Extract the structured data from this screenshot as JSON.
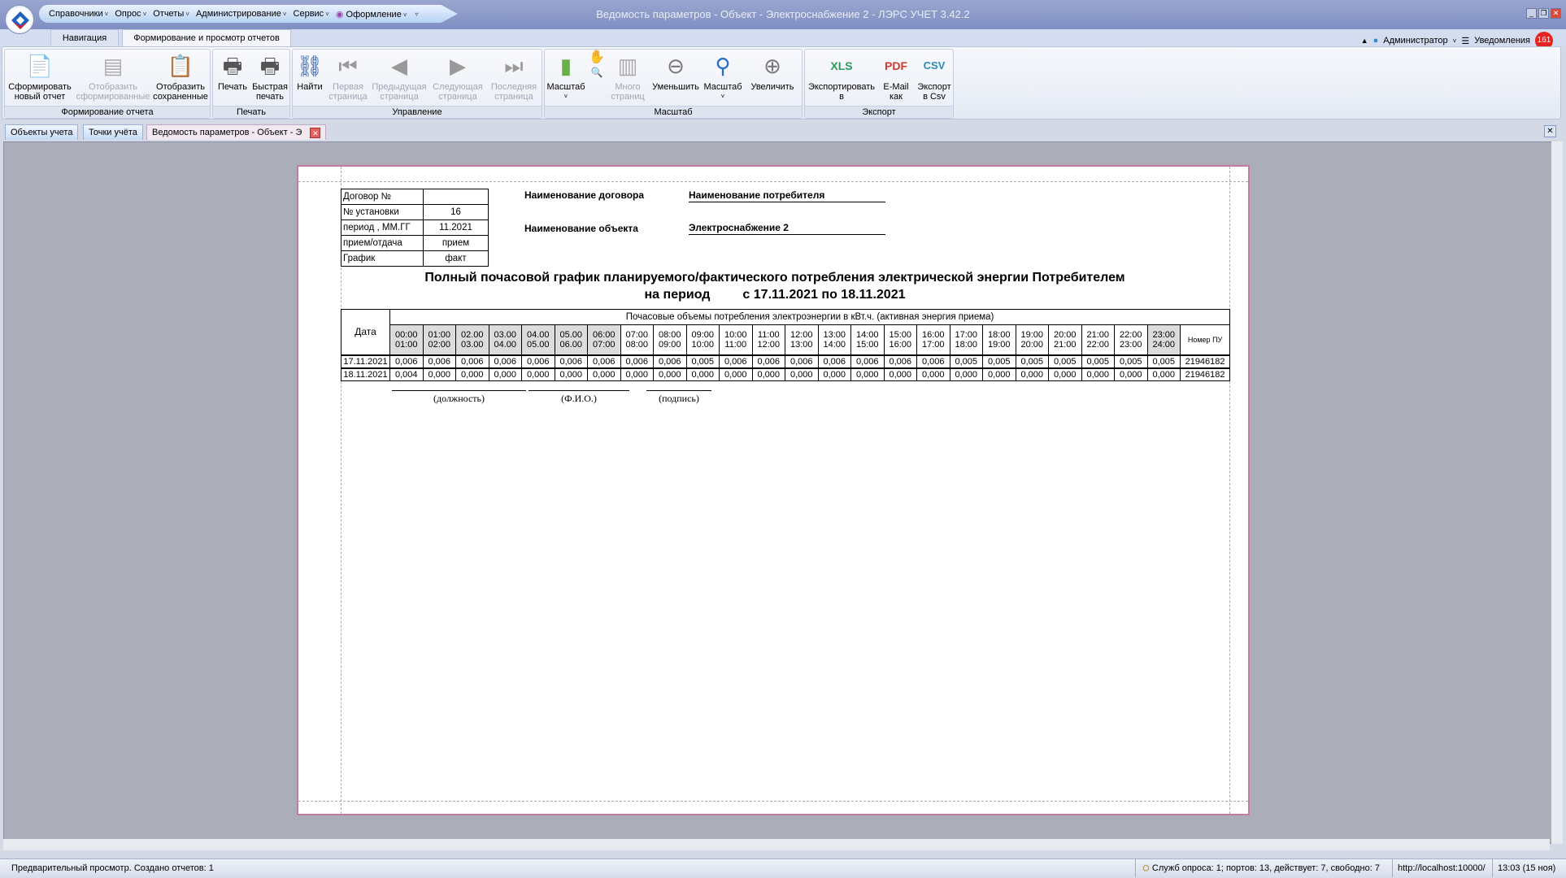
{
  "window": {
    "title": "Ведомость параметров - Объект - Электроснабжение 2 - ЛЭРС УЧЕТ 3.42.2"
  },
  "menu": [
    "Справочники",
    "Опрос",
    "Отчеты",
    "Администрирование",
    "Сервис",
    "Оформление"
  ],
  "ribbon_tabs": [
    "Навигация",
    "Формирование и просмотр отчетов"
  ],
  "user": {
    "name": "Администратор",
    "notifications_label": "Уведомления",
    "notifications_count": "161"
  },
  "groups": {
    "report": {
      "label": "Формирование отчета",
      "buttons": [
        "Сформировать\nновый отчет",
        "Отобразить\nсформированные",
        "Отобразить\nсохраненные"
      ]
    },
    "print": {
      "label": "Печать",
      "buttons": [
        "Печать",
        "Быстрая\nпечать"
      ]
    },
    "nav": {
      "label": "Управление",
      "buttons": [
        "Найти",
        "Первая\nстраница",
        "Предыдущая\nстраница",
        "Следующая\nстраница",
        "Последняя\nстраница"
      ]
    },
    "zoom": {
      "label": "Масштаб",
      "buttons": [
        "Масштаб",
        "Много\nстраниц",
        "Уменьшить",
        "Масштаб",
        "Увеличить"
      ]
    },
    "export": {
      "label": "Экспорт",
      "buttons": [
        "Экспортировать\nв",
        "E-Mail\nкак",
        "Экспорт\nв Csv"
      ]
    }
  },
  "doc_tabs": [
    "Объекты учета",
    "Точки учёта",
    "Ведомость параметров - Объект - Э"
  ],
  "report": {
    "info": [
      [
        "Договор №",
        ""
      ],
      [
        "№ установки",
        "16"
      ],
      [
        "период , ММ.ГГ",
        "11.2021"
      ],
      [
        "прием/отдача",
        "прием"
      ],
      [
        "График",
        "факт"
      ]
    ],
    "contract_label": "Наименование договора",
    "contract_value": "Наименование потребителя",
    "object_label": "Наименование объекта",
    "object_value": "Электроснабжение 2",
    "title": "Полный почасовой график планируемого/фактического потребления электрической энергии Потребителем",
    "period_label": "на период",
    "period_value": "с 17.11.2021 по 18.11.2021",
    "table_caption": "Почасовые объемы потребления электроэнергии в  кВт.ч. (активная энергия приема)",
    "date_header": "Дата",
    "meter_header": "Номер ПУ",
    "hours": [
      "00:00\n01:00",
      "01:00\n02:00",
      "02.00\n03.00",
      "03.00\n04.00",
      "04.00\n05.00",
      "05.00\n06.00",
      "06:00\n07:00",
      "07:00\n08:00",
      "08:00\n09:00",
      "09:00\n10:00",
      "10:00\n11:00",
      "11:00\n12:00",
      "12:00\n13:00",
      "13:00\n14:00",
      "14:00\n15:00",
      "15:00\n16:00",
      "16:00\n17:00",
      "17:00\n18:00",
      "18:00\n19:00",
      "19:00\n20:00",
      "20:00\n21:00",
      "21:00\n22:00",
      "22:00\n23:00",
      "23:00\n24:00"
    ],
    "shaded_hours": [
      0,
      1,
      2,
      3,
      4,
      5,
      6,
      23
    ],
    "rows": [
      {
        "date": "17.11.2021",
        "values": [
          "0,006",
          "0,006",
          "0,006",
          "0,006",
          "0,006",
          "0,006",
          "0,006",
          "0,006",
          "0,006",
          "0,005",
          "0,006",
          "0,006",
          "0,006",
          "0,006",
          "0,006",
          "0,006",
          "0,006",
          "0,005",
          "0,005",
          "0,005",
          "0,005",
          "0,005",
          "0,005",
          "0,005"
        ],
        "meter": "21946182"
      },
      {
        "date": "18.11.2021",
        "values": [
          "0,004",
          "0,000",
          "0,000",
          "0,000",
          "0,000",
          "0,000",
          "0,000",
          "0,000",
          "0,000",
          "0,000",
          "0,000",
          "0,000",
          "0,000",
          "0,000",
          "0,000",
          "0,000",
          "0,000",
          "0,000",
          "0,000",
          "0,000",
          "0,000",
          "0,000",
          "0,000",
          "0,000"
        ],
        "meter": "21946182"
      }
    ],
    "sig": [
      "(должность)",
      "(Ф.И.О.)",
      "(подпись)"
    ]
  },
  "status": {
    "left": "Предварительный просмотр.  Создано отчетов: 1",
    "services": "Служб опроса: 1; портов: 13, действует: 7, свободно: 7",
    "url": "http://localhost:10000/",
    "time": "13:03 (15 ноя)"
  }
}
